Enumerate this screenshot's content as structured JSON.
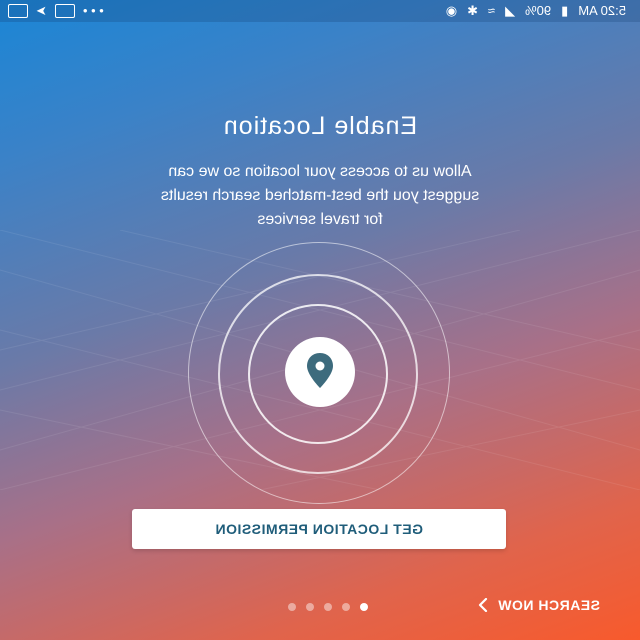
{
  "status_bar": {
    "time": "5:20 AM",
    "battery": "90%",
    "overflow": "• • •"
  },
  "onboarding": {
    "title": "Enable Location",
    "description": "Allow us to access your location so we can suggest you the best-matched search results for travel services",
    "cta_label": "GET LOCATION PERMISSION",
    "search_now_label": "SEARCH NOW",
    "page_count": 5,
    "active_page": 1
  },
  "colors": {
    "button_text": "#1f5d7a",
    "pin_color": "#3d6b7d",
    "gradient_top": "#1a86d6",
    "gradient_bottom": "#f85a2c"
  },
  "icons": {
    "location": "location-pin-icon",
    "chevron": "chevron-right-icon",
    "wifi": "wifi-icon",
    "bluetooth": "bluetooth-icon",
    "battery": "battery-icon"
  }
}
